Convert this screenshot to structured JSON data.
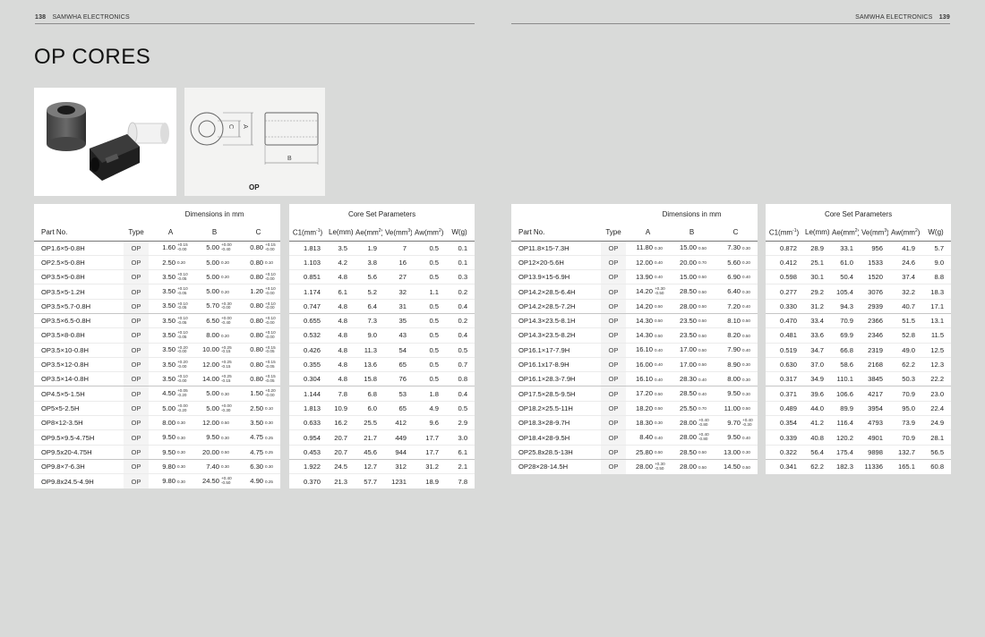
{
  "header": {
    "left_page": "138",
    "left_brand": "SAMWHA ELECTRONICS",
    "right_brand": "SAMWHA ELECTRONICS",
    "right_page": "139"
  },
  "title": "OP CORES",
  "drawing": {
    "label": "OP",
    "dim_a": "A",
    "dim_b": "B",
    "dim_c": "C"
  },
  "tables": {
    "dimensions_title": "Dimensions in mm",
    "params_title": "Core Set Parameters",
    "columns": {
      "part": "Part No.",
      "type": "Type",
      "a": "A",
      "b": "B",
      "c": "C",
      "c1": "C1",
      "c1_unit": "(mm",
      "c1_exp": "-1",
      "le": "Le",
      "le_unit": "(mm)",
      "ae": "Ae",
      "ae_unit": "(mm",
      "ve": "Ve",
      "ve_unit": "(mm",
      "aw": "Aw",
      "aw_unit": "(mm",
      "sq": "2",
      "cu": "3",
      "w": "W",
      "w_unit": "(g)"
    }
  },
  "left_rows": [
    {
      "part": "OP1.6×5-0.8H",
      "type": "OP",
      "a": "1.60",
      "a_tol": [
        "+0.15",
        "-0.00"
      ],
      "b": "5.00",
      "b_tol": [
        "+0.00",
        "-0.40"
      ],
      "c": "0.80",
      "c_tol": [
        "+0.15",
        "-0.00"
      ],
      "c1": "1.813",
      "le": "3.5",
      "ae": "1.9",
      "ve": "7",
      "aw": "0.5",
      "w": "0.1"
    },
    {
      "part": "OP2.5×5-0.8H",
      "type": "OP",
      "a": "2.50",
      "a_tol": [
        "0.20"
      ],
      "b": "5.00",
      "b_tol": [
        "0.20"
      ],
      "c": "0.80",
      "c_tol": [
        "0.10"
      ],
      "c1": "1.103",
      "le": "4.2",
      "ae": "3.8",
      "ve": "16",
      "aw": "0.5",
      "w": "0.1"
    },
    {
      "part": "OP3.5×5-0.8H",
      "type": "OP",
      "a": "3.50",
      "a_tol": [
        "+0.10",
        "-0.05"
      ],
      "b": "5.00",
      "b_tol": [
        "0.20"
      ],
      "c": "0.80",
      "c_tol": [
        "+0.10",
        "-0.00"
      ],
      "c1": "0.851",
      "le": "4.8",
      "ae": "5.6",
      "ve": "27",
      "aw": "0.5",
      "w": "0.3"
    },
    {
      "part": "OP3.5×5-1.2H",
      "type": "OP",
      "a": "3.50",
      "a_tol": [
        "+0.10",
        "-0.05"
      ],
      "b": "5.00",
      "b_tol": [
        "0.20"
      ],
      "c": "1.20",
      "c_tol": [
        "+0.10",
        "-0.00"
      ],
      "c1": "1.174",
      "le": "6.1",
      "ae": "5.2",
      "ve": "32",
      "aw": "1.1",
      "w": "0.2"
    },
    {
      "part": "OP3.5×5.7-0.8H",
      "type": "OP",
      "a": "3.50",
      "a_tol": [
        "+0.10",
        "-0.05"
      ],
      "b": "5.70",
      "b_tol": [
        "+0.30",
        "-0.00"
      ],
      "c": "0.80",
      "c_tol": [
        "+0.10",
        "-0.00"
      ],
      "c1": "0.747",
      "le": "4.8",
      "ae": "6.4",
      "ve": "31",
      "aw": "0.5",
      "w": "0.4",
      "end": true
    },
    {
      "part": "OP3.5×6.5-0.8H",
      "type": "OP",
      "a": "3.50",
      "a_tol": [
        "+0.10",
        "-0.05"
      ],
      "b": "6.50",
      "b_tol": [
        "+0.00",
        "-0.40"
      ],
      "c": "0.80",
      "c_tol": [
        "+0.10",
        "-0.00"
      ],
      "c1": "0.655",
      "le": "4.8",
      "ae": "7.3",
      "ve": "35",
      "aw": "0.5",
      "w": "0.2"
    },
    {
      "part": "OP3.5×8-0.8H",
      "type": "OP",
      "a": "3.50",
      "a_tol": [
        "+0.10",
        "-0.05"
      ],
      "b": "8.00",
      "b_tol": [
        "0.20"
      ],
      "c": "0.80",
      "c_tol": [
        "+0.10",
        "-0.00"
      ],
      "c1": "0.532",
      "le": "4.8",
      "ae": "9.0",
      "ve": "43",
      "aw": "0.5",
      "w": "0.4"
    },
    {
      "part": "OP3.5×10-0.8H",
      "type": "OP",
      "a": "3.50",
      "a_tol": [
        "+0.20",
        "-0.00"
      ],
      "b": "10.00",
      "b_tol": [
        "+0.25",
        "-0.15"
      ],
      "c": "0.80",
      "c_tol": [
        "+0.15",
        "-0.05"
      ],
      "c1": "0.426",
      "le": "4.8",
      "ae": "11.3",
      "ve": "54",
      "aw": "0.5",
      "w": "0.5"
    },
    {
      "part": "OP3.5×12-0.8H",
      "type": "OP",
      "a": "3.50",
      "a_tol": [
        "+0.20",
        "-0.00"
      ],
      "b": "12.00",
      "b_tol": [
        "+0.25",
        "-0.15"
      ],
      "c": "0.80",
      "c_tol": [
        "+0.15",
        "-0.05"
      ],
      "c1": "0.355",
      "le": "4.8",
      "ae": "13.6",
      "ve": "65",
      "aw": "0.5",
      "w": "0.7"
    },
    {
      "part": "OP3.5×14-0.8H",
      "type": "OP",
      "a": "3.50",
      "a_tol": [
        "+0.10",
        "-0.00"
      ],
      "b": "14.00",
      "b_tol": [
        "+0.25",
        "-0.15"
      ],
      "c": "0.80",
      "c_tol": [
        "+0.15",
        "-0.05"
      ],
      "c1": "0.304",
      "le": "4.8",
      "ae": "15.8",
      "ve": "76",
      "aw": "0.5",
      "w": "0.8",
      "end": true
    },
    {
      "part": "OP4.5×5-1.5H",
      "type": "OP",
      "a": "4.50",
      "a_tol": [
        "+0.05",
        "-0.20"
      ],
      "b": "5.00",
      "b_tol": [
        "0.30"
      ],
      "c": "1.50",
      "c_tol": [
        "+0.20",
        "-0.00"
      ],
      "c1": "1.144",
      "le": "7.8",
      "ae": "6.8",
      "ve": "53",
      "aw": "1.8",
      "w": "0.4"
    },
    {
      "part": "OP5×5-2.5H",
      "type": "OP",
      "a": "5.00",
      "a_tol": [
        "+0.00",
        "-0.20"
      ],
      "b": "5.00",
      "b_tol": [
        "+0.00",
        "-0.30"
      ],
      "c": "2.50",
      "c_tol": [
        "0.10"
      ],
      "c1": "1.813",
      "le": "10.9",
      "ae": "6.0",
      "ve": "65",
      "aw": "4.9",
      "w": "0.5"
    },
    {
      "part": "OP8×12-3.5H",
      "type": "OP",
      "a": "8.00",
      "a_tol": [
        "0.30"
      ],
      "b": "12.00",
      "b_tol": [
        "0.50"
      ],
      "c": "3.50",
      "c_tol": [
        "0.30"
      ],
      "c1": "0.633",
      "le": "16.2",
      "ae": "25.5",
      "ve": "412",
      "aw": "9.6",
      "w": "2.9"
    },
    {
      "part": "OP9.5×9.5-4.75H",
      "type": "OP",
      "a": "9.50",
      "a_tol": [
        "0.30"
      ],
      "b": "9.50",
      "b_tol": [
        "0.30"
      ],
      "c": "4.75",
      "c_tol": [
        "0.25"
      ],
      "c1": "0.954",
      "le": "20.7",
      "ae": "21.7",
      "ve": "449",
      "aw": "17.7",
      "w": "3.0"
    },
    {
      "part": "OP9.5x20-4.75H",
      "type": "OP",
      "a": "9.50",
      "a_tol": [
        "0.30"
      ],
      "b": "20.00",
      "b_tol": [
        "0.50"
      ],
      "c": "4.75",
      "c_tol": [
        "0.25"
      ],
      "c1": "0.453",
      "le": "20.7",
      "ae": "45.6",
      "ve": "944",
      "aw": "17.7",
      "w": "6.1",
      "end": true
    },
    {
      "part": "OP9.8×7-6.3H",
      "type": "OP",
      "a": "9.80",
      "a_tol": [
        "0.30"
      ],
      "b": "7.40",
      "b_tol": [
        "0.30"
      ],
      "c": "6.30",
      "c_tol": [
        "0.30"
      ],
      "c1": "1.922",
      "le": "24.5",
      "ae": "12.7",
      "ve": "312",
      "aw": "31.2",
      "w": "2.1"
    },
    {
      "part": "OP9.8x24.5-4.9H",
      "type": "OP",
      "a": "9.80",
      "a_tol": [
        "0.30"
      ],
      "b": "24.50",
      "b_tol": [
        "+0.40",
        "-0.50"
      ],
      "c": "4.90",
      "c_tol": [
        "0.25"
      ],
      "c1": "0.370",
      "le": "21.3",
      "ae": "57.7",
      "ve": "1231",
      "aw": "18.9",
      "w": "7.8"
    }
  ],
  "right_rows": [
    {
      "part": "OP11.8×15-7.3H",
      "type": "OP",
      "a": "11.80",
      "a_tol": [
        "0.30"
      ],
      "b": "15.00",
      "b_tol": [
        "0.50"
      ],
      "c": "7.30",
      "c_tol": [
        "0.30"
      ],
      "c1": "0.872",
      "le": "28.9",
      "ae": "33.1",
      "ve": "956",
      "aw": "41.9",
      "w": "5.7"
    },
    {
      "part": "OP12×20-5.6H",
      "type": "OP",
      "a": "12.00",
      "a_tol": [
        "0.40"
      ],
      "b": "20.00",
      "b_tol": [
        "0.70"
      ],
      "c": "5.60",
      "c_tol": [
        "0.20"
      ],
      "c1": "0.412",
      "le": "25.1",
      "ae": "61.0",
      "ve": "1533",
      "aw": "24.6",
      "w": "9.0"
    },
    {
      "part": "OP13.9×15-6.9H",
      "type": "OP",
      "a": "13.90",
      "a_tol": [
        "0.40"
      ],
      "b": "15.00",
      "b_tol": [
        "0.50"
      ],
      "c": "6.90",
      "c_tol": [
        "0.40"
      ],
      "c1": "0.598",
      "le": "30.1",
      "ae": "50.4",
      "ve": "1520",
      "aw": "37.4",
      "w": "8.8"
    },
    {
      "part": "OP14.2×28.5-6.4H",
      "type": "OP",
      "a": "14.20",
      "a_tol": [
        "+0.30",
        "-0.50"
      ],
      "b": "28.50",
      "b_tol": [
        "0.50"
      ],
      "c": "6.40",
      "c_tol": [
        "0.30"
      ],
      "c1": "0.277",
      "le": "29.2",
      "ae": "105.4",
      "ve": "3076",
      "aw": "32.2",
      "w": "18.3"
    },
    {
      "part": "OP14.2×28.5-7.2H",
      "type": "OP",
      "a": "14.20",
      "a_tol": [
        "0.50"
      ],
      "b": "28.00",
      "b_tol": [
        "0.50"
      ],
      "c": "7.20",
      "c_tol": [
        "0.40"
      ],
      "c1": "0.330",
      "le": "31.2",
      "ae": "94.3",
      "ve": "2939",
      "aw": "40.7",
      "w": "17.1",
      "end": true
    },
    {
      "part": "OP14.3×23.5-8.1H",
      "type": "OP",
      "a": "14.30",
      "a_tol": [
        "0.50"
      ],
      "b": "23.50",
      "b_tol": [
        "0.50"
      ],
      "c": "8.10",
      "c_tol": [
        "0.50"
      ],
      "c1": "0.470",
      "le": "33.4",
      "ae": "70.9",
      "ve": "2366",
      "aw": "51.5",
      "w": "13.1"
    },
    {
      "part": "OP14.3×23.5-8.2H",
      "type": "OP",
      "a": "14.30",
      "a_tol": [
        "0.50"
      ],
      "b": "23.50",
      "b_tol": [
        "0.50"
      ],
      "c": "8.20",
      "c_tol": [
        "0.50"
      ],
      "c1": "0.481",
      "le": "33.6",
      "ae": "69.9",
      "ve": "2346",
      "aw": "52.8",
      "w": "11.5"
    },
    {
      "part": "OP16.1×17-7.9H",
      "type": "OP",
      "a": "16.10",
      "a_tol": [
        "0.40"
      ],
      "b": "17.00",
      "b_tol": [
        "0.50"
      ],
      "c": "7.90",
      "c_tol": [
        "0.40"
      ],
      "c1": "0.519",
      "le": "34.7",
      "ae": "66.8",
      "ve": "2319",
      "aw": "49.0",
      "w": "12.5"
    },
    {
      "part": "OP16.1x17-8.9H",
      "type": "OP",
      "a": "16.00",
      "a_tol": [
        "0.40"
      ],
      "b": "17.00",
      "b_tol": [
        "0.50"
      ],
      "c": "8.90",
      "c_tol": [
        "0.30"
      ],
      "c1": "0.630",
      "le": "37.0",
      "ae": "58.6",
      "ve": "2168",
      "aw": "62.2",
      "w": "12.3"
    },
    {
      "part": "OP16.1×28.3-7.9H",
      "type": "OP",
      "a": "16.10",
      "a_tol": [
        "0.40"
      ],
      "b": "28.30",
      "b_tol": [
        "0.40"
      ],
      "c": "8.00",
      "c_tol": [
        "0.30"
      ],
      "c1": "0.317",
      "le": "34.9",
      "ae": "110.1",
      "ve": "3845",
      "aw": "50.3",
      "w": "22.2",
      "end": true
    },
    {
      "part": "OP17.5×28.5-9.5H",
      "type": "OP",
      "a": "17.20",
      "a_tol": [
        "0.50"
      ],
      "b": "28.50",
      "b_tol": [
        "0.40"
      ],
      "c": "9.50",
      "c_tol": [
        "0.30"
      ],
      "c1": "0.371",
      "le": "39.6",
      "ae": "106.6",
      "ve": "4217",
      "aw": "70.9",
      "w": "23.0"
    },
    {
      "part": "OP18.2×25.5-11H",
      "type": "OP",
      "a": "18.20",
      "a_tol": [
        "0.50"
      ],
      "b": "25.50",
      "b_tol": [
        "0.70"
      ],
      "c": "11.00",
      "c_tol": [
        "0.50"
      ],
      "c1": "0.489",
      "le": "44.0",
      "ae": "89.9",
      "ve": "3954",
      "aw": "95.0",
      "w": "22.4"
    },
    {
      "part": "OP18.3×28-9.7H",
      "type": "OP",
      "a": "18.30",
      "a_tol": [
        "0.30"
      ],
      "b": "28.00",
      "b_tol": [
        "+0.40",
        "-0.80"
      ],
      "c": "9.70",
      "c_tol": [
        "+0.40",
        "-0.30"
      ],
      "c1": "0.354",
      "le": "41.2",
      "ae": "116.4",
      "ve": "4793",
      "aw": "73.9",
      "w": "24.9"
    },
    {
      "part": "OP18.4×28-9.5H",
      "type": "OP",
      "a": "8.40",
      "a_tol": [
        "0.40"
      ],
      "b": "28.00",
      "b_tol": [
        "+0.40",
        "-0.80"
      ],
      "c": "9.50",
      "c_tol": [
        "0.40"
      ],
      "c1": "0.339",
      "le": "40.8",
      "ae": "120.2",
      "ve": "4901",
      "aw": "70.9",
      "w": "28.1"
    },
    {
      "part": "OP25.8x28.5-13H",
      "type": "OP",
      "a": "25.80",
      "a_tol": [
        "0.50"
      ],
      "b": "28.50",
      "b_tol": [
        "0.50"
      ],
      "c": "13.00",
      "c_tol": [
        "0.30"
      ],
      "c1": "0.322",
      "le": "56.4",
      "ae": "175.4",
      "ve": "9898",
      "aw": "132.7",
      "w": "56.5",
      "end": true
    },
    {
      "part": "OP28×28-14.5H",
      "type": "OP",
      "a": "28.00",
      "a_tol": [
        "+0.30",
        "-0.50"
      ],
      "b": "28.00",
      "b_tol": [
        "0.50"
      ],
      "c": "14.50",
      "c_tol": [
        "0.50"
      ],
      "c1": "0.341",
      "le": "62.2",
      "ae": "182.3",
      "ve": "11336",
      "aw": "165.1",
      "w": "60.8"
    }
  ]
}
